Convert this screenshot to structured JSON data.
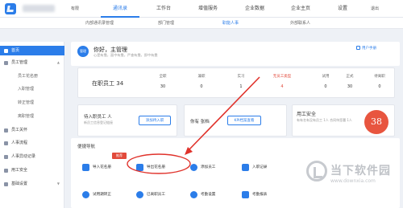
{
  "top_nav": {
    "company_suffix": "有限",
    "items": [
      "通讯录",
      "工作台",
      "增值服务",
      "企业数据",
      "企业主页",
      "设置"
    ],
    "exit": "退出",
    "active_index": 0
  },
  "sub_nav": {
    "items": [
      "内部通讯录管理",
      "部门管理",
      "职能人事",
      "外部联系人"
    ],
    "active_index": 2
  },
  "sidebar": {
    "items": [
      {
        "label": "首页",
        "active": true
      },
      {
        "label": "员工管理",
        "caret": "▲"
      },
      {
        "label": "员工花名册",
        "sub": true
      },
      {
        "label": "入职管理",
        "sub": true
      },
      {
        "label": "转正管理",
        "sub": true
      },
      {
        "label": "离职管理",
        "sub": true
      },
      {
        "label": "员工关怀"
      },
      {
        "label": "人事流程"
      },
      {
        "label": "人事异动记录"
      },
      {
        "label": "用工安全"
      },
      {
        "label": "基础设置",
        "caret": "▼"
      }
    ]
  },
  "header": {
    "avatar_text": "管理",
    "greeting": "你好，主管理",
    "subtitle": "心是有靠，面中有靠，严查有靠，即中有靠",
    "manual": "用户手册"
  },
  "stats": {
    "on_job_label": "在职员工",
    "on_job_value": "34",
    "items": [
      {
        "label": "全职",
        "value": "30"
      },
      {
        "label": "兼职",
        "value": "0"
      },
      {
        "label": "实习",
        "value": "1"
      },
      {
        "label": "无员工类型",
        "value": "4",
        "red": true
      },
      {
        "label": "试用",
        "value": "0"
      },
      {
        "label": "正式",
        "value": "30"
      },
      {
        "label": "待离职",
        "value": "0"
      }
    ]
  },
  "tasks": {
    "pending_title": "待入职员工 人",
    "pending_sub": "新员工信息登记链接",
    "pending_button": "添加待入职",
    "birthday_title": "你有 张档",
    "birthday_button": "KPI档案查看"
  },
  "safety": {
    "title": "用工安全",
    "subtitle": "有有名有没有员工 1人 合同待签署 1人",
    "score": "38"
  },
  "shortcuts": {
    "title": "便捷导航",
    "badge": "推荐",
    "items": [
      "导入花名册",
      "导出花名册",
      "添加员工",
      "入职记录",
      "试用期转正",
      "已离职员工",
      "考勤设置",
      "考勤报表"
    ]
  },
  "watermark": {
    "cn": "当下软件园",
    "url": "www.downxia.com"
  }
}
